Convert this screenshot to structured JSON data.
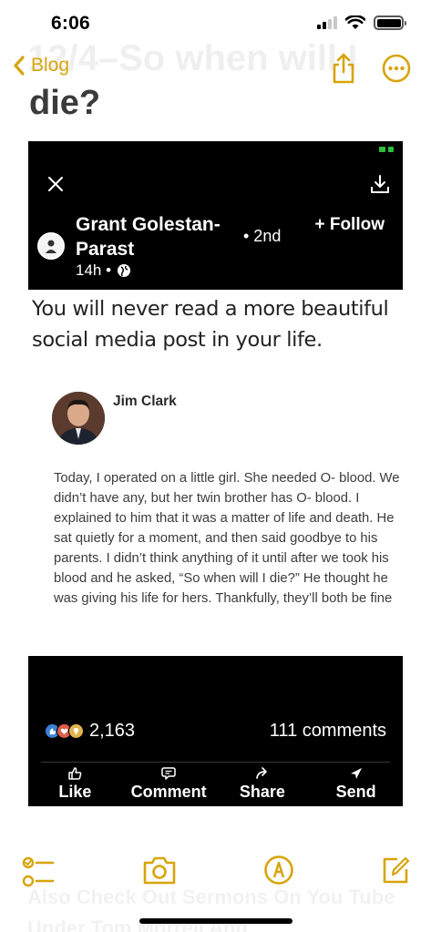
{
  "status_bar": {
    "time": "6:06"
  },
  "nav": {
    "back_label": "Blog"
  },
  "note": {
    "title_ghost": "12/4–So when will I",
    "title": "die?",
    "footer_ghost": "Also Check Out Sermons On You Tube Under Tom Morrell And"
  },
  "post": {
    "author": "Grant Golestan-Parast",
    "degree": "• 2nd",
    "follow": "+ Follow",
    "time": "14h •",
    "headline": "You will never read a more beautiful social media post in your life.",
    "quoted_author": "Jim Clark",
    "quoted_text": "Today, I operated on a little girl. She needed O- blood. We didn’t have any, but her twin brother has O- blood. I explained to him that it was a matter of life and death. He sat quietly for a moment, and then said goodbye to his parents. I didn’t think anything of it until after we took his blood and he asked, “So when will I die?” He thought he was giving his life for hers. Thankfully, they’ll both be fine",
    "reaction_count": "2,163",
    "comments": "111 comments",
    "actions": [
      "Like",
      "Comment",
      "Share",
      "Send"
    ]
  },
  "icons": {
    "nav": [
      "chevron-left-icon",
      "share-icon",
      "more-icon"
    ],
    "toolbar": [
      "checklist-icon",
      "camera-icon",
      "markup-icon",
      "compose-icon"
    ]
  },
  "colors": {
    "accent": "#d7a40a",
    "post_bg": "#000000"
  }
}
